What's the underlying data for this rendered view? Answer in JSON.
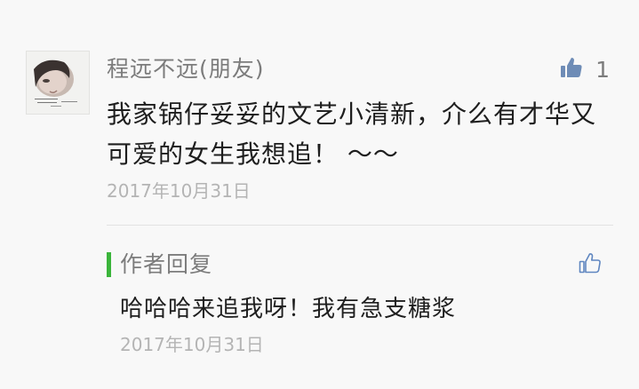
{
  "comment": {
    "author": "程远不远(朋友)",
    "like_count": "1",
    "content": "我家锅仔妥妥的文艺小清新，介么有才华又可爱的女生我想追！ ～～",
    "date": "2017年10月31日",
    "avatar_icon": "user-avatar-photo",
    "like_icon": "thumbs-up-filled-icon"
  },
  "reply": {
    "label": "作者回复",
    "content": "哈哈哈来追我呀！我有急支糖浆",
    "date": "2017年10月31日",
    "like_icon": "thumbs-up-outline-icon"
  },
  "colors": {
    "background": "#f8f8f8",
    "accent_bar": "#3bb53b",
    "like_filled": "#6e8cb6",
    "like_outline": "#5f86c0",
    "secondary_text": "#7c7c7c",
    "date_text": "#b4b4b4",
    "primary_text": "#1e1e1e"
  }
}
